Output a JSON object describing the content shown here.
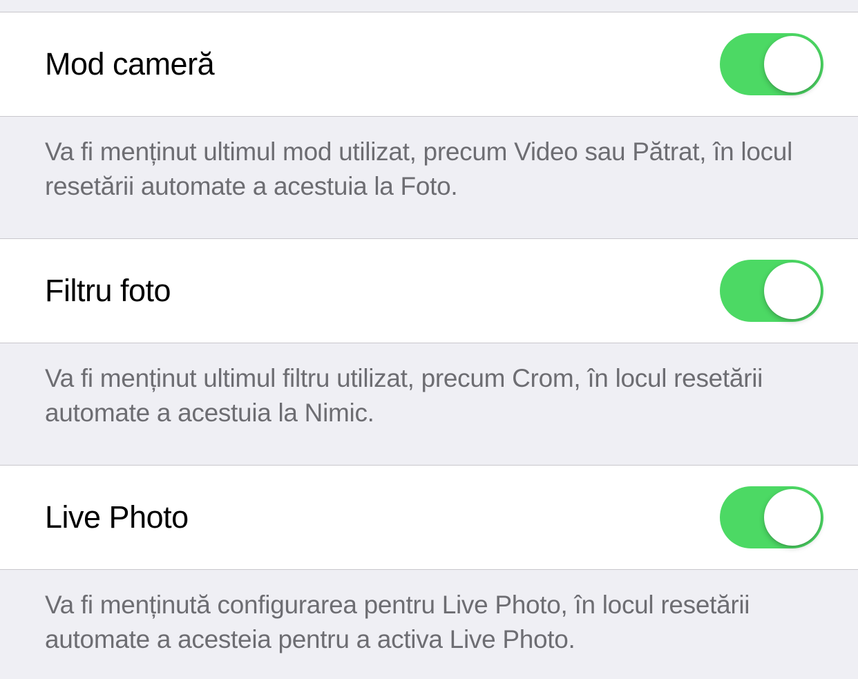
{
  "settings": [
    {
      "label": "Mod cameră",
      "description": "Va fi menținut ultimul mod utilizat, precum Video sau Pătrat, în locul resetării automate a acestuia la Foto.",
      "enabled": true
    },
    {
      "label": "Filtru foto",
      "description": "Va fi menținut ultimul filtru utilizat, precum Crom, în locul resetării automate a acestuia la Nimic.",
      "enabled": true
    },
    {
      "label": "Live Photo",
      "description": "Va fi menținută configurarea pentru Live Photo, în locul resetării automate a acesteia pentru a activa Live Photo.",
      "enabled": true
    }
  ]
}
